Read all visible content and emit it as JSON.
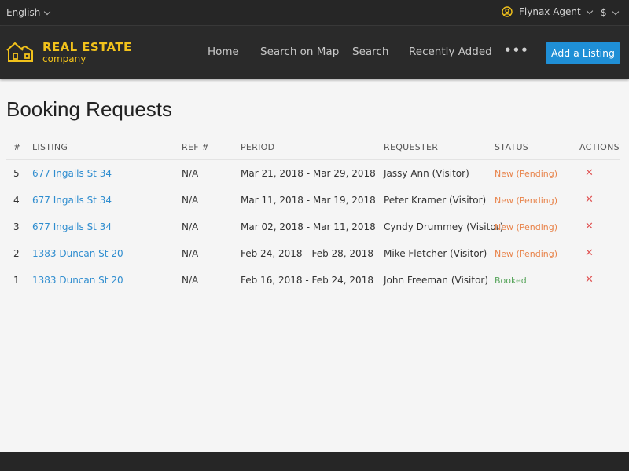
{
  "topbar": {
    "language": "English",
    "agent": "Flynax Agent",
    "currency": "$"
  },
  "logo": {
    "line1": "REAL ESTATE",
    "line2": "company"
  },
  "nav": {
    "items": [
      "Home",
      "Search on Map",
      "Search",
      "Recently Added"
    ],
    "more": "•••",
    "add_listing": "Add a Listing"
  },
  "page": {
    "title": "Booking Requests"
  },
  "table": {
    "headers": {
      "num": "#",
      "listing": "LISTING",
      "ref": "REF #",
      "period": "PERIOD",
      "requester": "REQUESTER",
      "status": "STATUS",
      "actions": "ACTIONS"
    },
    "rows": [
      {
        "num": "5",
        "listing": "677 Ingalls St 34",
        "ref": "N/A",
        "period": "Mar 21, 2018 - Mar 29, 2018",
        "requester": "Jassy Ann (Visitor)",
        "status": "New (Pending)",
        "action": "✕"
      },
      {
        "num": "4",
        "listing": "677 Ingalls St 34",
        "ref": "N/A",
        "period": "Mar 11, 2018 - Mar 19, 2018",
        "requester": "Peter Kramer (Visitor)",
        "status": "New (Pending)",
        "action": "✕"
      },
      {
        "num": "3",
        "listing": "677 Ingalls St 34",
        "ref": "N/A",
        "period": "Mar 02, 2018 - Mar 11, 2018",
        "requester": "Cyndy Drummey (Visitor)",
        "status": "New (Pending)",
        "action": "✕"
      },
      {
        "num": "2",
        "listing": "1383 Duncan St 20",
        "ref": "N/A",
        "period": "Feb 24, 2018 - Feb 28, 2018",
        "requester": "Mike Fletcher (Visitor)",
        "status": "New (Pending)",
        "action": "✕"
      },
      {
        "num": "1",
        "listing": "1383 Duncan St 20",
        "ref": "N/A",
        "period": "Feb 16, 2018 - Feb 24, 2018",
        "requester": "John Freeman (Visitor)",
        "status": "Booked",
        "action": "✕"
      }
    ]
  },
  "colors": {
    "accent": "#1f8fd6",
    "brand": "#f2c21b",
    "link": "#2f8dcf",
    "pending": "#e8834a",
    "booked": "#58a55c",
    "delete": "#e05656"
  },
  "icons": {
    "language_dropdown": "chevron-down-icon",
    "agent": "user-circle-icon",
    "currency_dropdown": "chevron-down-icon",
    "logo": "house-icon",
    "delete": "close-icon"
  }
}
